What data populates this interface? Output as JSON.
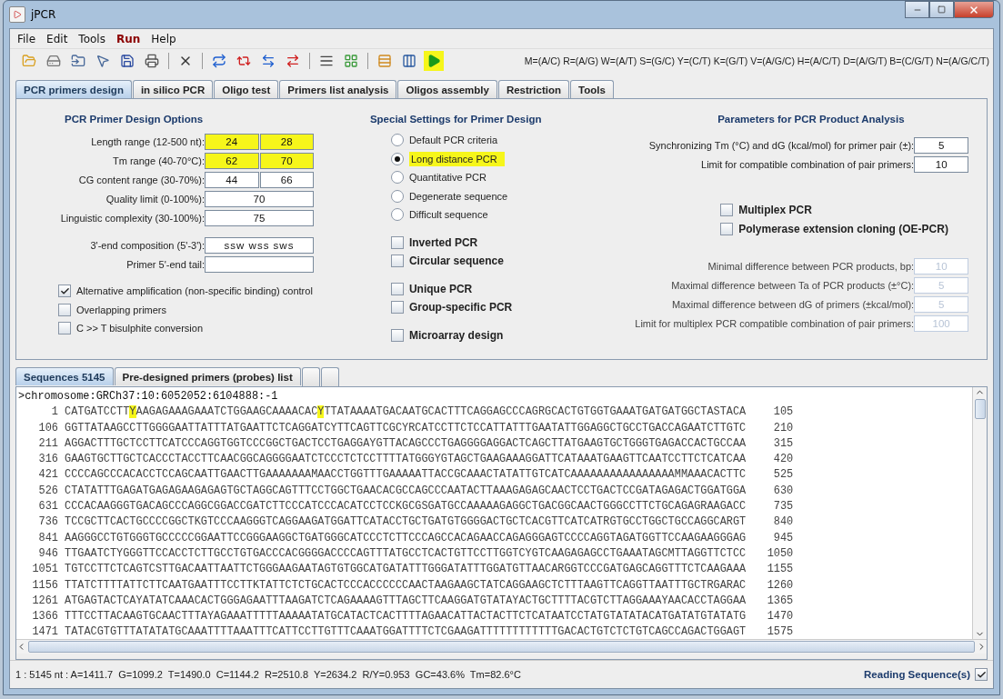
{
  "window": {
    "title": "jPCR"
  },
  "menu": [
    {
      "label": "File",
      "highlighted": false
    },
    {
      "label": "Edit",
      "highlighted": false
    },
    {
      "label": "Tools",
      "highlighted": false
    },
    {
      "label": "Run",
      "highlighted": true
    },
    {
      "label": "Help",
      "highlighted": false
    }
  ],
  "code_legend": "M=(A/C) R=(A/G) W=(A/T) S=(G/C) Y=(C/T) K=(G/T) V=(A/G/C) H=(A/C/T) D=(A/G/T) B=(C/G/T) N=(A/G/C/T)",
  "tabs": [
    {
      "label": "PCR primers design",
      "selected": true
    },
    {
      "label": "in silico PCR",
      "selected": false
    },
    {
      "label": "Oligo test",
      "selected": false
    },
    {
      "label": "Primers list analysis",
      "selected": false
    },
    {
      "label": "Oligos assembly",
      "selected": false
    },
    {
      "label": "Restriction",
      "selected": false
    },
    {
      "label": "Tools",
      "selected": false
    }
  ],
  "design_options": {
    "title": "PCR Primer Design Options",
    "fields": [
      {
        "label": "Length range (12-500 nt):",
        "values": [
          "24",
          "28"
        ],
        "highlighted": true
      },
      {
        "label": "Tm range (40-70°C):",
        "values": [
          "62",
          "70"
        ],
        "highlighted": true
      },
      {
        "label": "CG content range (30-70%):",
        "values": [
          "44",
          "66"
        ],
        "highlighted": false
      },
      {
        "label": "Quality limit (0-100%):",
        "values": [
          "70"
        ],
        "highlighted": false
      },
      {
        "label": "Linguistic complexity (30-100%):",
        "values": [
          "75"
        ],
        "highlighted": false
      }
    ],
    "end_fields": [
      {
        "label": "3'-end composition (5'-3'):",
        "values": [
          "ssw wss sws"
        ]
      },
      {
        "label": "Primer 5'-end tail:"
      }
    ],
    "checkboxes": [
      {
        "label": "Alternative amplification (non-specific binding) control",
        "checked": true
      },
      {
        "label": "Overlapping primers",
        "checked": false
      },
      {
        "label": "C >> T bisulphite conversion",
        "checked": false
      }
    ]
  },
  "special_settings": {
    "title": "Special Settings for Primer Design",
    "options": [
      {
        "label": "Default PCR criteria",
        "selected": false,
        "highlighted": false
      },
      {
        "label": "Long distance PCR",
        "selected": true,
        "highlighted": true
      },
      {
        "label": "Quantitative PCR",
        "selected": false,
        "highlighted": false
      },
      {
        "label": "Degenerate sequence",
        "selected": false,
        "highlighted": false
      },
      {
        "label": "Difficult sequence",
        "selected": false,
        "highlighted": false
      }
    ],
    "checkbox_groups": [
      {
        "items": [
          {
            "label": "Inverted PCR",
            "checked": false
          },
          {
            "label": "Circular sequence",
            "checked": false
          }
        ]
      },
      {
        "items": [
          {
            "label": "Unique PCR",
            "checked": false
          },
          {
            "label": "Group-specific PCR",
            "checked": false
          }
        ]
      },
      {
        "items": [
          {
            "label": "Microarray design",
            "checked": false
          }
        ]
      }
    ]
  },
  "product_analysis": {
    "title": "Parameters for PCR Product Analysis",
    "fields": [
      {
        "label": "Synchronizing Tm (°C) and dG (kcal/mol) for primer pair (±):",
        "value": "5",
        "disabled": false
      },
      {
        "label": "Limit for compatible combination of pair primers:",
        "value": "10",
        "disabled": false
      }
    ],
    "checkboxes": [
      {
        "label": "Multiplex PCR",
        "checked": false
      },
      {
        "label": "Polymerase extension cloning (OE-PCR)",
        "checked": false
      }
    ],
    "multiplex_fields": [
      {
        "label": "Minimal difference between PCR products, bp:",
        "value": "10",
        "disabled": true
      },
      {
        "label": "Maximal difference between Ta of PCR products (±°C):",
        "value": "5",
        "disabled": true
      },
      {
        "label": "Maximal difference between dG of primers (±kcal/mol):",
        "value": "5",
        "disabled": true
      },
      {
        "label": "Limit for multiplex PCR compatible combination of pair primers:",
        "value": "100",
        "disabled": true
      }
    ]
  },
  "lower_tabs": [
    {
      "label": "Sequences 5145",
      "selected": true
    },
    {
      "label": "Pre-designed primers (probes) list",
      "selected": false
    }
  ],
  "sequence": {
    "header": ">chromosome:GRCh37:10:6052052:6104888:-1",
    "rows": [
      {
        "start": "1",
        "end": "105",
        "parts": [
          {
            "text": "CATGATCCTT",
            "highlighted": false
          },
          {
            "text": "Y",
            "highlighted": true
          },
          {
            "text": "AAGAGAAAGAAATCTGGAAGCAAAACAC",
            "highlighted": false
          },
          {
            "text": "Y",
            "highlighted": true
          },
          {
            "text": "TTATAAAATGACAATGCACTTTCAGGAGCCCAGRGCACTGTGGTGAAATGATGATGGCTASTACA",
            "highlighted": false
          }
        ]
      },
      {
        "start": "106",
        "end": "210",
        "parts": [
          {
            "text": "GGTTATAAGCCTTGGGGAATTATTTATGAATTCTCAGGATCYTTCAGTTCGCYRCATCCTTCTCCATTATTTGAATATTGGAGGCTGCCTGACCAGAATCTTGTC",
            "highlighted": false
          }
        ]
      },
      {
        "start": "211",
        "end": "315",
        "parts": [
          {
            "text": "AGGACTTTGCTCCTTCATCCCAGGTGGTCCCGGCTGACTCCTGAGGAYGTTACAGCCCTGAGGGGAGGACTCAGCTTATGAAGTGCTGGGTGAGACCACTGCCAA",
            "highlighted": false
          }
        ]
      },
      {
        "start": "316",
        "end": "420",
        "parts": [
          {
            "text": "GAAGTGCTTGCTCACCCTACCTTCAACGGCAGGGGAATCTCCCTCTCCTTTTATGGGYGTAGCTGAAGAAAGGATTCATAAATGAAGTTCAATCCTTCTCATCAA",
            "highlighted": false
          }
        ]
      },
      {
        "start": "421",
        "end": "525",
        "parts": [
          {
            "text": "CCCCAGCCCACACCTCCAGCAATTGAACTTGAAAAAAAMAACCTGGTTTGAAAAATTACCGCAAACTATATTGTCATCAAAAAAAAAAAAAAAAMMAAACACTTC",
            "highlighted": false
          }
        ]
      },
      {
        "start": "526",
        "end": "630",
        "parts": [
          {
            "text": "CTATATTTGAGATGAGAGAAGAGAGTGCTAGGCAGTTTCCTGGCTGAACACGCCAGCCCAATACTTAAAGAGAGCAACTCCTGACTCCGATAGAGACTGGATGGA",
            "highlighted": false
          }
        ]
      },
      {
        "start": "631",
        "end": "735",
        "parts": [
          {
            "text": "CCCACAAGGGTGACAGCCCAGGCGGACCGATCTTCCCATCCCACATCCTCCKGCGSGATGCCAAAAAGAGGCTGACGGCAACTGGGCCTTCTGCAGAGRAAGACC",
            "highlighted": false
          }
        ]
      },
      {
        "start": "736",
        "end": "840",
        "parts": [
          {
            "text": "TCCGCTTCACTGCCCCGGCTKGTCCCAAGGGTCAGGAAGATGGATTCATACCTGCTGATGTGGGGACTGCTCACGTTCATCATRGTGCCTGGCTGCCAGGCARGT",
            "highlighted": false
          }
        ]
      },
      {
        "start": "841",
        "end": "945",
        "parts": [
          {
            "text": "AAGGGCCTGTGGGTGCCCCCGGAATTCCGGGAAGGCTGATGGGCATCCCTCTTCCCAGCCACAGAACCAGAGGGAGTCCCCAGGTAGATGGTTCCAAGAAGGGAG",
            "highlighted": false
          }
        ]
      },
      {
        "start": "946",
        "end": "1050",
        "parts": [
          {
            "text": "TTGAATCTYGGGTTCCACCTCTTGCCTGTGACCCACGGGGACCCCAGTTTATGCCTCACTGTTCCTTGGTCYGTCAAGAGAGCCTGAAATAGCMTTAGGTTCTCC",
            "highlighted": false
          }
        ]
      },
      {
        "start": "1051",
        "end": "1155",
        "parts": [
          {
            "text": "TGTCCTTCTCAGTCSTTGACAATTAATTCTGGGAAGAATAGTGTGGCATGATATTTGGGATATTTGGATGTTAACARGGTCCCGATGAGCAGGTTTCTCAAGAAA",
            "highlighted": false
          }
        ]
      },
      {
        "start": "1156",
        "end": "1260",
        "parts": [
          {
            "text": "TTATCTTTTATTCTTCAATGAATTTCCTTKTATTCTCTGCACTCCCACCCCCCAACTAAGAAGCTATCAGGAAGCTCTTTAAGTTCAGGTTAATTTGCTRGARAC",
            "highlighted": false
          }
        ]
      },
      {
        "start": "1261",
        "end": "1365",
        "parts": [
          {
            "text": "ATGAGTACTCAYATATCAAACACTGGGAGAATTTAAGATCTCAGAAAAGTTTAGCTTCAAGGATGTATAYACTGCTTTTACGTCTTAGGAAAYAACACCTAGGAA",
            "highlighted": false
          }
        ]
      },
      {
        "start": "1366",
        "end": "1470",
        "parts": [
          {
            "text": "TTTCCTTACAAGTGCAACTTTAYAGAAATTTTTAAAAATATGCATACTCACTTTTAGAACATTACTACTTCTCATAATCCTATGTATATACATGATATGTATATG",
            "highlighted": false
          }
        ]
      },
      {
        "start": "1471",
        "end": "1575",
        "parts": [
          {
            "text": "TATACGTGTTTATATATGCAAATTTTAAATTTCATTCCTTGTTTCAAATGGATTTTCTCGAAGATTTTTTTTTTTTGACACTGTCTCTGTCAGCCAGACTGGAGT",
            "highlighted": false
          }
        ]
      }
    ]
  },
  "status_bar": {
    "text": "1 : 5145 nt : A=1411.7  G=1099.2  T=1490.0  C=1144.2  R=2510.8  Y=2634.2  R/Y=0.953  GC=43.6%  Tm=82.6°C",
    "reading_label": "Reading Sequence(s)",
    "reading_checked": true
  }
}
